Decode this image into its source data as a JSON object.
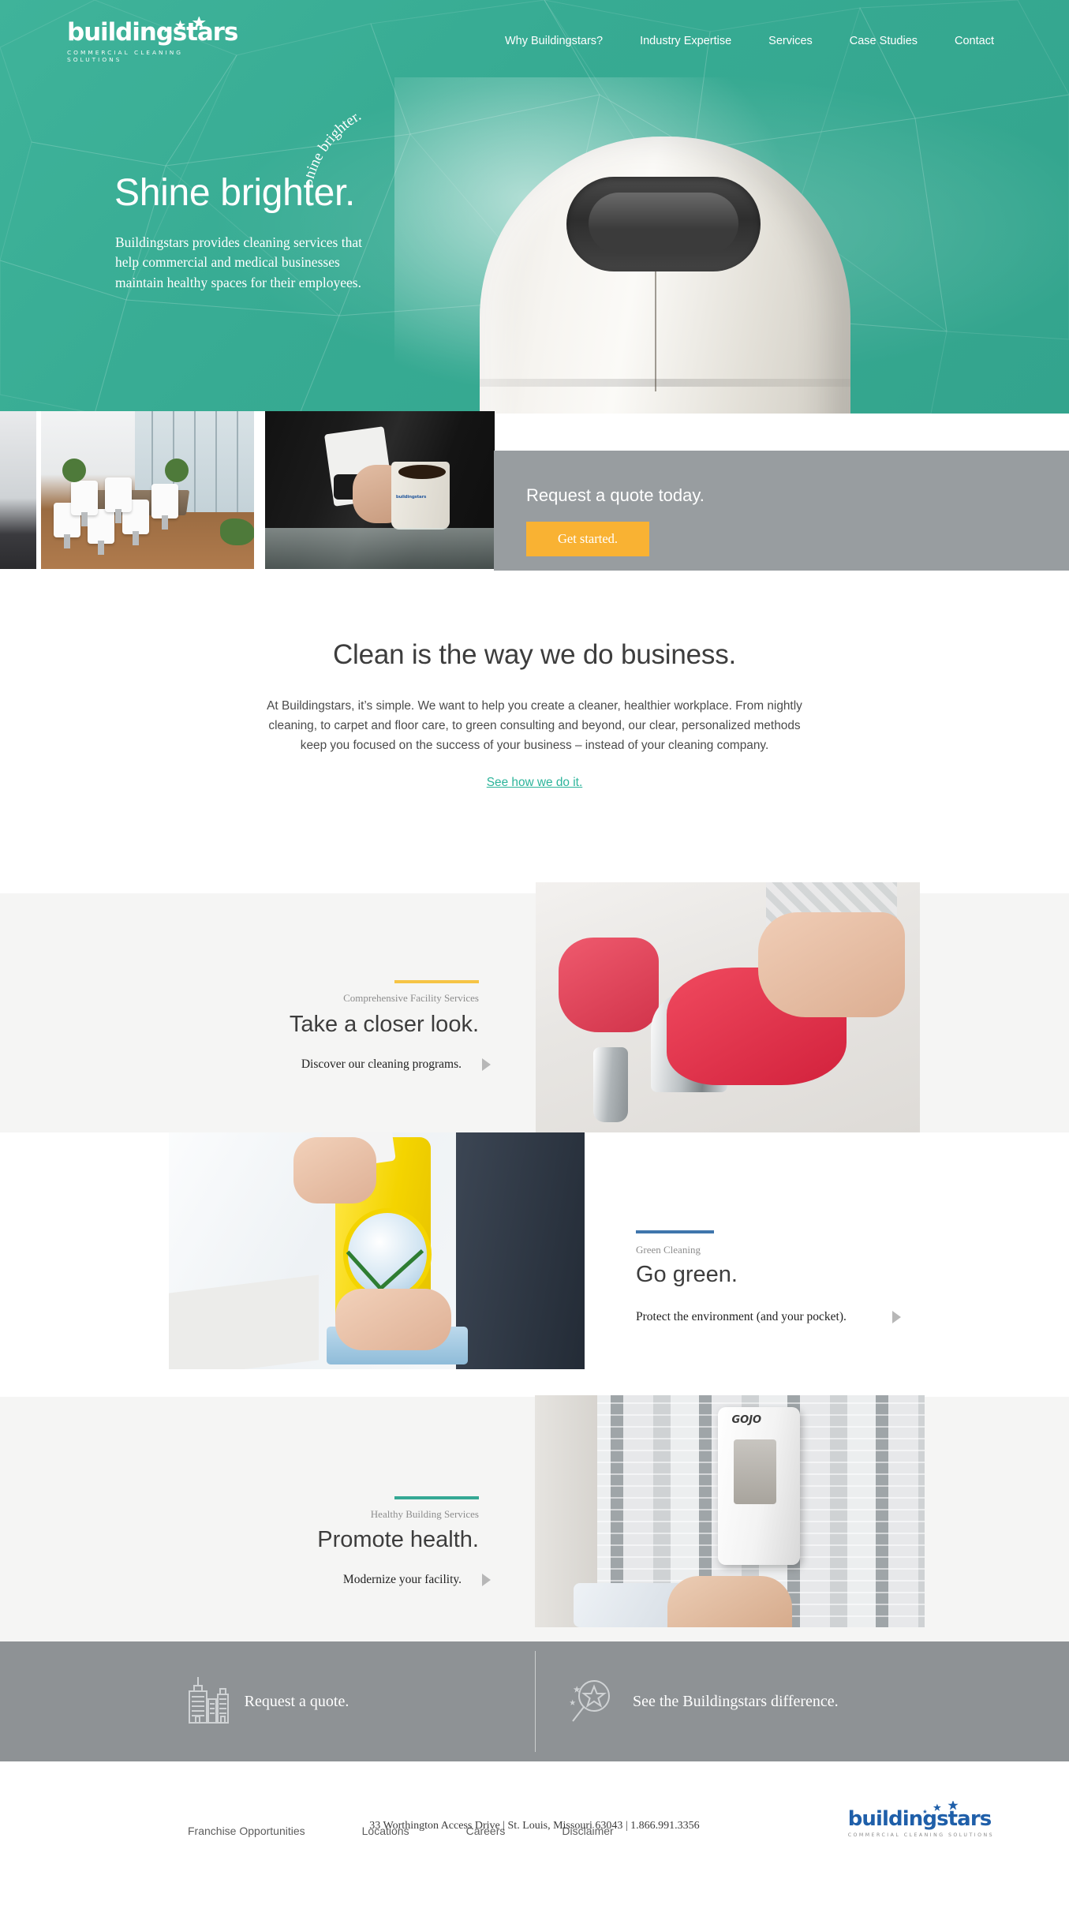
{
  "brand": {
    "name": "buildingstars",
    "tagline": "COMMERCIAL CLEANING SOLUTIONS",
    "teal": "#38ad95",
    "blue": "#1f5fa9",
    "amber": "#f9b233",
    "gray": "#8e9295"
  },
  "nav": {
    "items": [
      {
        "label": "Why Buildingstars?"
      },
      {
        "label": "Industry Expertise"
      },
      {
        "label": "Services"
      },
      {
        "label": "Case Studies"
      },
      {
        "label": "Contact"
      }
    ]
  },
  "hero": {
    "heading": "Shine brighter.",
    "paragraph": "Buildingstars provides cleaning services that help commercial and medical businesses maintain healthy spaces for their employees.",
    "curved_text": "Shine brighter."
  },
  "quote_banner": {
    "heading": "Request a quote today.",
    "button_label": "Get started."
  },
  "intro": {
    "heading": "Clean is the way we do business.",
    "paragraph": "At Buildingstars, it’s simple. We want to help you create a cleaner, healthier workplace. From nightly cleaning, to carpet and floor care, to green consulting and beyond, our clear, personalized methods keep you focused on the success of your business – instead of your cleaning company.",
    "link_label": "See how we do it."
  },
  "features": [
    {
      "kicker": "Comprehensive Facility Services",
      "title": "Take a closer look.",
      "link": "Discover our cleaning programs.",
      "rule_color": "#f6c445"
    },
    {
      "kicker": "Green Cleaning",
      "title": "Go green.",
      "link": "Protect the environment (and your pocket).",
      "rule_color": "#3f76ac"
    },
    {
      "kicker": "Healthy Building Services",
      "title": "Promote health.",
      "link": "Modernize your facility.",
      "rule_color": "#35a894"
    }
  ],
  "cta": {
    "items": [
      {
        "label": "Request a quote.",
        "icon": "buildings-icon"
      },
      {
        "label": "See the Buildingstars difference.",
        "icon": "magnifier-star-icon"
      }
    ]
  },
  "footer": {
    "links": [
      {
        "label": "Franchise Opportunities"
      },
      {
        "label": "Locations"
      },
      {
        "label": "Careers"
      },
      {
        "label": "Disclaimer"
      }
    ],
    "address": "33 Worthington Access Drive | St. Louis, Missouri 63043 | 1.866.991.3356"
  }
}
